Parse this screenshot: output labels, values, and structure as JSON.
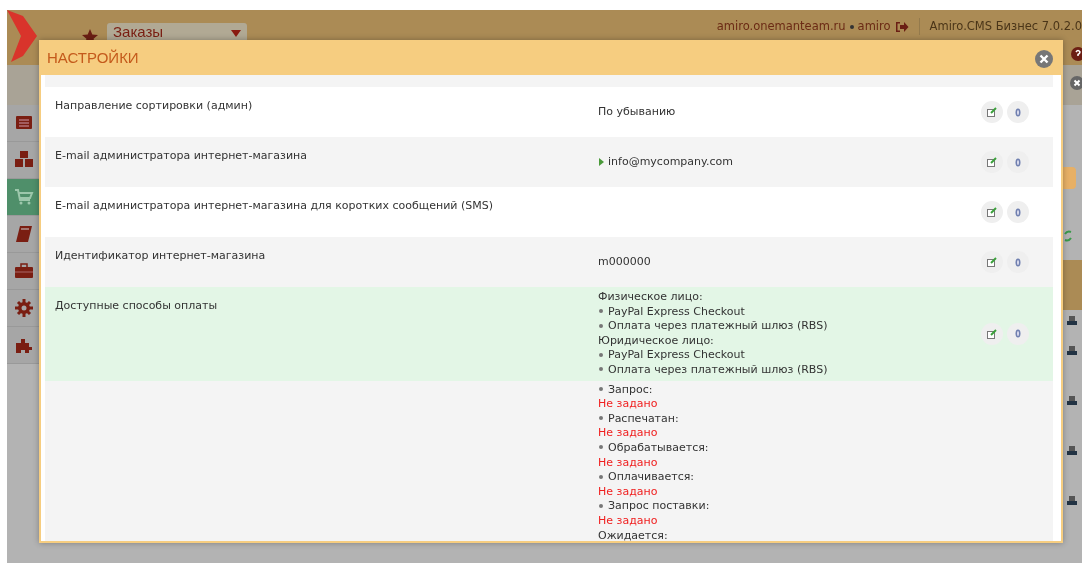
{
  "header": {
    "module": "Заказы",
    "host": "amiro.onemanteam.ru",
    "user": "amiro",
    "product": "Amiro.CMS Бизнес 7.0.2.0"
  },
  "sidebar": {
    "items": [
      {
        "kind": "list",
        "selected": false
      },
      {
        "kind": "boxes",
        "selected": false
      },
      {
        "kind": "cart",
        "selected": true
      },
      {
        "kind": "book",
        "selected": false
      },
      {
        "kind": "briefcase",
        "selected": false
      },
      {
        "kind": "gear",
        "selected": false
      },
      {
        "kind": "puzzle",
        "selected": false
      }
    ]
  },
  "modal": {
    "title": "НАСТРОЙКИ",
    "rows": [
      {
        "label": "Направление сортировки (админ)",
        "highlighted": false,
        "value": [
          {
            "kind": "text",
            "text": "По убыванию"
          }
        ]
      },
      {
        "label": "E-mail администратора интернет-магазина",
        "highlighted": false,
        "value": [
          {
            "kind": "expandable",
            "text": "info@mycompany.com"
          }
        ]
      },
      {
        "label": "E-mail администратора интернет-магазина для коротких сообщений (SMS)",
        "highlighted": false,
        "value": []
      },
      {
        "label": "Идентификатор интернет-магазина",
        "highlighted": false,
        "value": [
          {
            "kind": "text",
            "text": "m000000"
          }
        ]
      },
      {
        "label": "Доступные способы оплаты",
        "highlighted": true,
        "value": [
          {
            "kind": "heading",
            "text": "Физическое лицо:"
          },
          {
            "kind": "bullet",
            "text": "PayPal Express Checkout"
          },
          {
            "kind": "bullet",
            "text": "Оплата через платежный шлюз (RBS)"
          },
          {
            "kind": "heading",
            "text": "Юридическое лицо:"
          },
          {
            "kind": "bullet",
            "text": "PayPal Express Checkout"
          },
          {
            "kind": "bullet",
            "text": "Оплата через платежный шлюз (RBS)"
          }
        ]
      },
      {
        "label": "",
        "highlighted": false,
        "actions": false,
        "value": [
          {
            "kind": "bullet",
            "text": "Запрос:"
          },
          {
            "kind": "unset",
            "text": "Не задано"
          },
          {
            "kind": "bullet",
            "text": "Распечатан:"
          },
          {
            "kind": "unset",
            "text": "Не задано"
          },
          {
            "kind": "bullet",
            "text": "Обрабатывается:"
          },
          {
            "kind": "unset",
            "text": "Не задано"
          },
          {
            "kind": "bullet",
            "text": "Оплачивается:"
          },
          {
            "kind": "unset",
            "text": "Не задано"
          },
          {
            "kind": "bullet",
            "text": "Запрос поставки:"
          },
          {
            "kind": "unset",
            "text": "Не задано"
          },
          {
            "kind": "heading",
            "text": "Ожидается:"
          }
        ]
      }
    ]
  }
}
